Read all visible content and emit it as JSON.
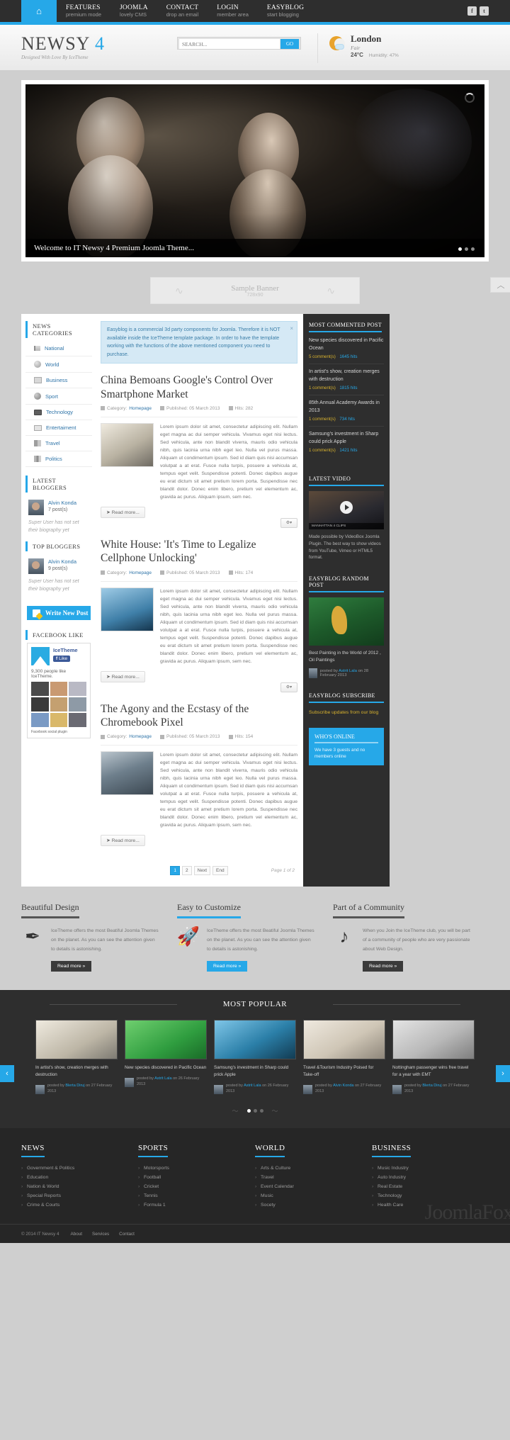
{
  "topbar": {
    "home_icon": "home-icon",
    "menu": [
      {
        "title": "FEATURES",
        "sub": "premium mode"
      },
      {
        "title": "JOOMLA",
        "sub": "lovely CMS"
      },
      {
        "title": "CONTACT",
        "sub": "drop an email"
      },
      {
        "title": "LOGIN",
        "sub": "member area"
      },
      {
        "title": "EASYBLOG",
        "sub": "start blogging"
      }
    ],
    "social": [
      {
        "name": "facebook-icon",
        "glyph": "f"
      },
      {
        "name": "twitter-icon",
        "glyph": "t"
      }
    ]
  },
  "header": {
    "logo_main": "NEWSY",
    "logo_num": "4",
    "tagline": "Designed With Love By IceTheme",
    "search": {
      "placeholder": "SEARCH...",
      "value": "",
      "go_label": "GO"
    },
    "weather": {
      "icon": "moon-cloud-icon",
      "city": "London",
      "condition": "Fair",
      "temp": "24°C",
      "humidity": "Humidity: 47%"
    }
  },
  "slider": {
    "caption": "Welcome to IT Newsy 4 Premium Joomla Theme...",
    "dots": 3,
    "active_dot": 0,
    "loading_icon": "spinner-icon"
  },
  "banner": {
    "title": "Sample Banner",
    "size": "728x90",
    "to_top_icon": "chevron-up-icon"
  },
  "left_sidebar": {
    "categories_title": "NEWS CATEGORIES",
    "categories": [
      {
        "label": "National",
        "icon": "flag-icon"
      },
      {
        "label": "World",
        "icon": "globe-icon"
      },
      {
        "label": "Business",
        "icon": "newspaper-icon"
      },
      {
        "label": "Sport",
        "icon": "ball-icon"
      },
      {
        "label": "Technology",
        "icon": "monitor-icon"
      },
      {
        "label": "Entertaiment",
        "icon": "picture-icon"
      },
      {
        "label": "Travel",
        "icon": "book-icon"
      },
      {
        "label": "Politics",
        "icon": "podium-icon"
      }
    ],
    "latest_bloggers_title": "LATEST BLOGGERS",
    "latest_blogger": {
      "name": "Alvin Konda",
      "posts": "7 post(s)",
      "bio": "Super User has not set their biography yet"
    },
    "top_bloggers_title": "TOP BLOGGERS",
    "top_blogger": {
      "name": "Alvin Konda",
      "posts": "9 post(s)",
      "bio": "Super User has not set their biography yet"
    },
    "write_post_label": "Write New Post",
    "facebook_title": "FACEBOOK LIKE",
    "facebook": {
      "page_name": "IceTheme",
      "like_label": "Like",
      "count_text": "9,300 people like IceTheme.",
      "footer": "Facebook social plugin"
    }
  },
  "main": {
    "alert": "Easyblog is a commercial 3d party components for Joomla. Therefore it is NOT available inside the IceTheme template package. In order to have the template working with the functions of the above mentioned component you need to purchase.",
    "alert_close": "×",
    "read_more": "Read more...",
    "gear_label": "⚙",
    "articles": [
      {
        "title": "China Bemoans Google's Control Over Smartphone Market",
        "category_label": "Category:",
        "category": "Homepage",
        "published": "Published: 05 March 2013",
        "hits": "Hits: 282",
        "text": "Lorem ipsum dolor sit amet, consectetur adipiscing elit. Nullam eget magna ac dui semper vehicula. Vivamus eget nisi lectus. Sed vehicula, ante non blandit viverra, mauris odio vehicula nibh, quis lacinia urna nibh eget leo. Nulla vel purus massa. Aliquam ut condimentum ipsum. Sed id diam quis nisi accumsan volutpat a at erat. Fusce nulla turpis, posuere a vehicula at, tempus eget velit. Suspendisse potenti. Donec dapibus augue eu erat dictum sit amet pretium lorem porta. Suspendisse nec blandit dolor. Donec enim libero, pretium vel elementum ac, gravida ac purus. Aliquam ipsum, sem nec."
      },
      {
        "title": "White House: 'It's Time to Legalize Cellphone Unlocking'",
        "category_label": "Category:",
        "category": "Homepage",
        "published": "Published: 05 March 2013",
        "hits": "Hits: 174",
        "text": "Lorem ipsum dolor sit amet, consectetur adipiscing elit. Nullam eget magna ac dui semper vehicula. Vivamus eget nisi lectus. Sed vehicula, ante non blandit viverra, mauris odio vehicula nibh, quis lacinia urna nibh eget leo. Nulla vel purus massa. Aliquam ut condimentum ipsum. Sed id diam quis nisi accumsan volutpat a at erat. Fusce nulla turpis, posuere a vehicula at, tempus eget velit. Suspendisse potenti. Donec dapibus augue eu erat dictum sit amet pretium lorem porta. Suspendisse nec blandit dolor. Donec enim libero, pretium vel elementum ac, gravida ac purus. Aliquam ipsum, sem nec."
      },
      {
        "title": "The Agony and the Ecstasy of the Chromebook Pixel",
        "category_label": "Category:",
        "category": "Homepage",
        "published": "Published: 05 March 2013",
        "hits": "Hits: 154",
        "text": "Lorem ipsum dolor sit amet, consectetur adipiscing elit. Nullam eget magna ac dui semper vehicula. Vivamus eget nisi lectus. Sed vehicula, ante non blandit viverra, mauris odio vehicula nibh, quis lacinia urna nibh eget leo. Nulla vel purus massa. Aliquam ut condimentum ipsum. Sed id diam quis nisi accumsan volutpat a at erat. Fusce nulla turpis, posuere a vehicula at, tempus eget velit. Suspendisse potenti. Donec dapibus augue eu erat dictum sit amet pretium lorem porta. Suspendisse nec blandit dolor. Donec enim libero, pretium vel elementum ac, gravida ac purus. Aliquam ipsum, sem nec."
      }
    ],
    "pagination": {
      "pages": [
        "1",
        "2",
        "Next",
        "End"
      ],
      "active": "1",
      "page_of": "Page 1 of 2"
    }
  },
  "right_sidebar": {
    "most_commented_title": "MOST COMMENTED POST",
    "most_commented": [
      {
        "title": "New species discovered in Pacific Ocean",
        "comments": "5 comment(s)",
        "hits": "1645 hits"
      },
      {
        "title": "In artist's show, creation merges with destruction",
        "comments": "1 comment(s)",
        "hits": "1815 hits"
      },
      {
        "title": "85th Annual Academy Awards in 2013",
        "comments": "1 comment(s)",
        "hits": "734 hits"
      },
      {
        "title": "Samsung's investment in Sharp could prick Apple",
        "comments": "1 comment(s)",
        "hits": "1421 hits"
      }
    ],
    "latest_video_title": "LATEST VIDEO",
    "video": {
      "play_icon": "play-icon",
      "bar_text": "MANHATTAN 4 CLIPS",
      "desc": "Made possible by VideoBox Joomla Plugin. The best way to show videos from YouTube, Vimeo or HTML5 format."
    },
    "random_post_title": "EASYBLOG RANDOM POST",
    "random_post": {
      "caption": "Best Painting in the World of 2012 , Oil Paintings",
      "posted_by": "posted by",
      "author": "Astrit Lala",
      "date": "on 28 February 2013"
    },
    "subscribe_title": "EASYBLOG SUBSCRIBE",
    "subscribe_link": "Subscribe updates from our blog",
    "online_title": "WHO'S ONLINE",
    "online_text": "We have 3 guests and no members online"
  },
  "features": [
    {
      "title": "Beautiful Design",
      "icon": "brush-icon",
      "glyph": "✒",
      "text": "IceTheme offers the most Beatiful Joomla Themes on the planet. As you can see the attention given to details is astonishing.",
      "button": "Read more »",
      "accent": "#3a3a3a"
    },
    {
      "title": "Easy to Customize",
      "icon": "rocket-icon",
      "glyph": "🚀",
      "text": "IceTheme offers the most Beatiful Joomla Themes on the planet. As you can see the attention given to details is astonishing.",
      "button": "Read more »",
      "accent": "#26a8e8"
    },
    {
      "title": "Part of a Community",
      "icon": "music-note-icon",
      "glyph": "♪",
      "text": "When you Join the IceTheme club, you will be part of a community of people who are very passionate about Web Design.",
      "button": "Read more »",
      "accent": "#3a3a3a"
    }
  ],
  "popular": {
    "title": "MOST POPULAR",
    "prev_icon": "chevron-left-icon",
    "next_icon": "chevron-right-icon",
    "cards": [
      {
        "text": "In artist's show, creation merges with destruction",
        "by": "posted by",
        "author": "Blerta Diruj",
        "date": "on 27 February 2013"
      },
      {
        "text": "New species discovered in Pacific Ocean",
        "by": "posted by",
        "author": "Astrit Lala",
        "date": "on 26 February 2013"
      },
      {
        "text": "Samsung's investment in Sharp could prick Apple",
        "by": "posted by",
        "author": "Astrit Lala",
        "date": "on 26 February 2013"
      },
      {
        "text": "Travel &Tourism Industry Poised for Take-off",
        "by": "posted by",
        "author": "Alvin Konda",
        "date": "on 27 February 2013"
      },
      {
        "text": "Nottingham passenger wins free travel for a year with EMT",
        "by": "posted by",
        "author": "Blerta Diruj",
        "date": "on 27 February 2013"
      }
    ],
    "dots": 3,
    "active_dot": 0
  },
  "footer": {
    "watermark": "JoomlaFox",
    "columns": [
      {
        "title": "NEWS",
        "items": [
          "Government & Politics",
          "Education",
          "Nation & World",
          "Special Reports",
          "Crime & Courts"
        ]
      },
      {
        "title": "SPORTS",
        "items": [
          "Motorsports",
          "Football",
          "Cricket",
          "Tennis",
          "Formula 1"
        ]
      },
      {
        "title": "WORLD",
        "items": [
          "Arts & Culture",
          "Travel",
          "Event Calendar",
          "Music",
          "Socety"
        ]
      },
      {
        "title": "BUSINESS",
        "items": [
          "Music Industry",
          "Auto Industry",
          "Real Estate",
          "Technology",
          "Health Care"
        ]
      }
    ],
    "copyright": "© 2014 IT Newsy 4",
    "links": [
      "About",
      "Services",
      "Contact"
    ]
  }
}
